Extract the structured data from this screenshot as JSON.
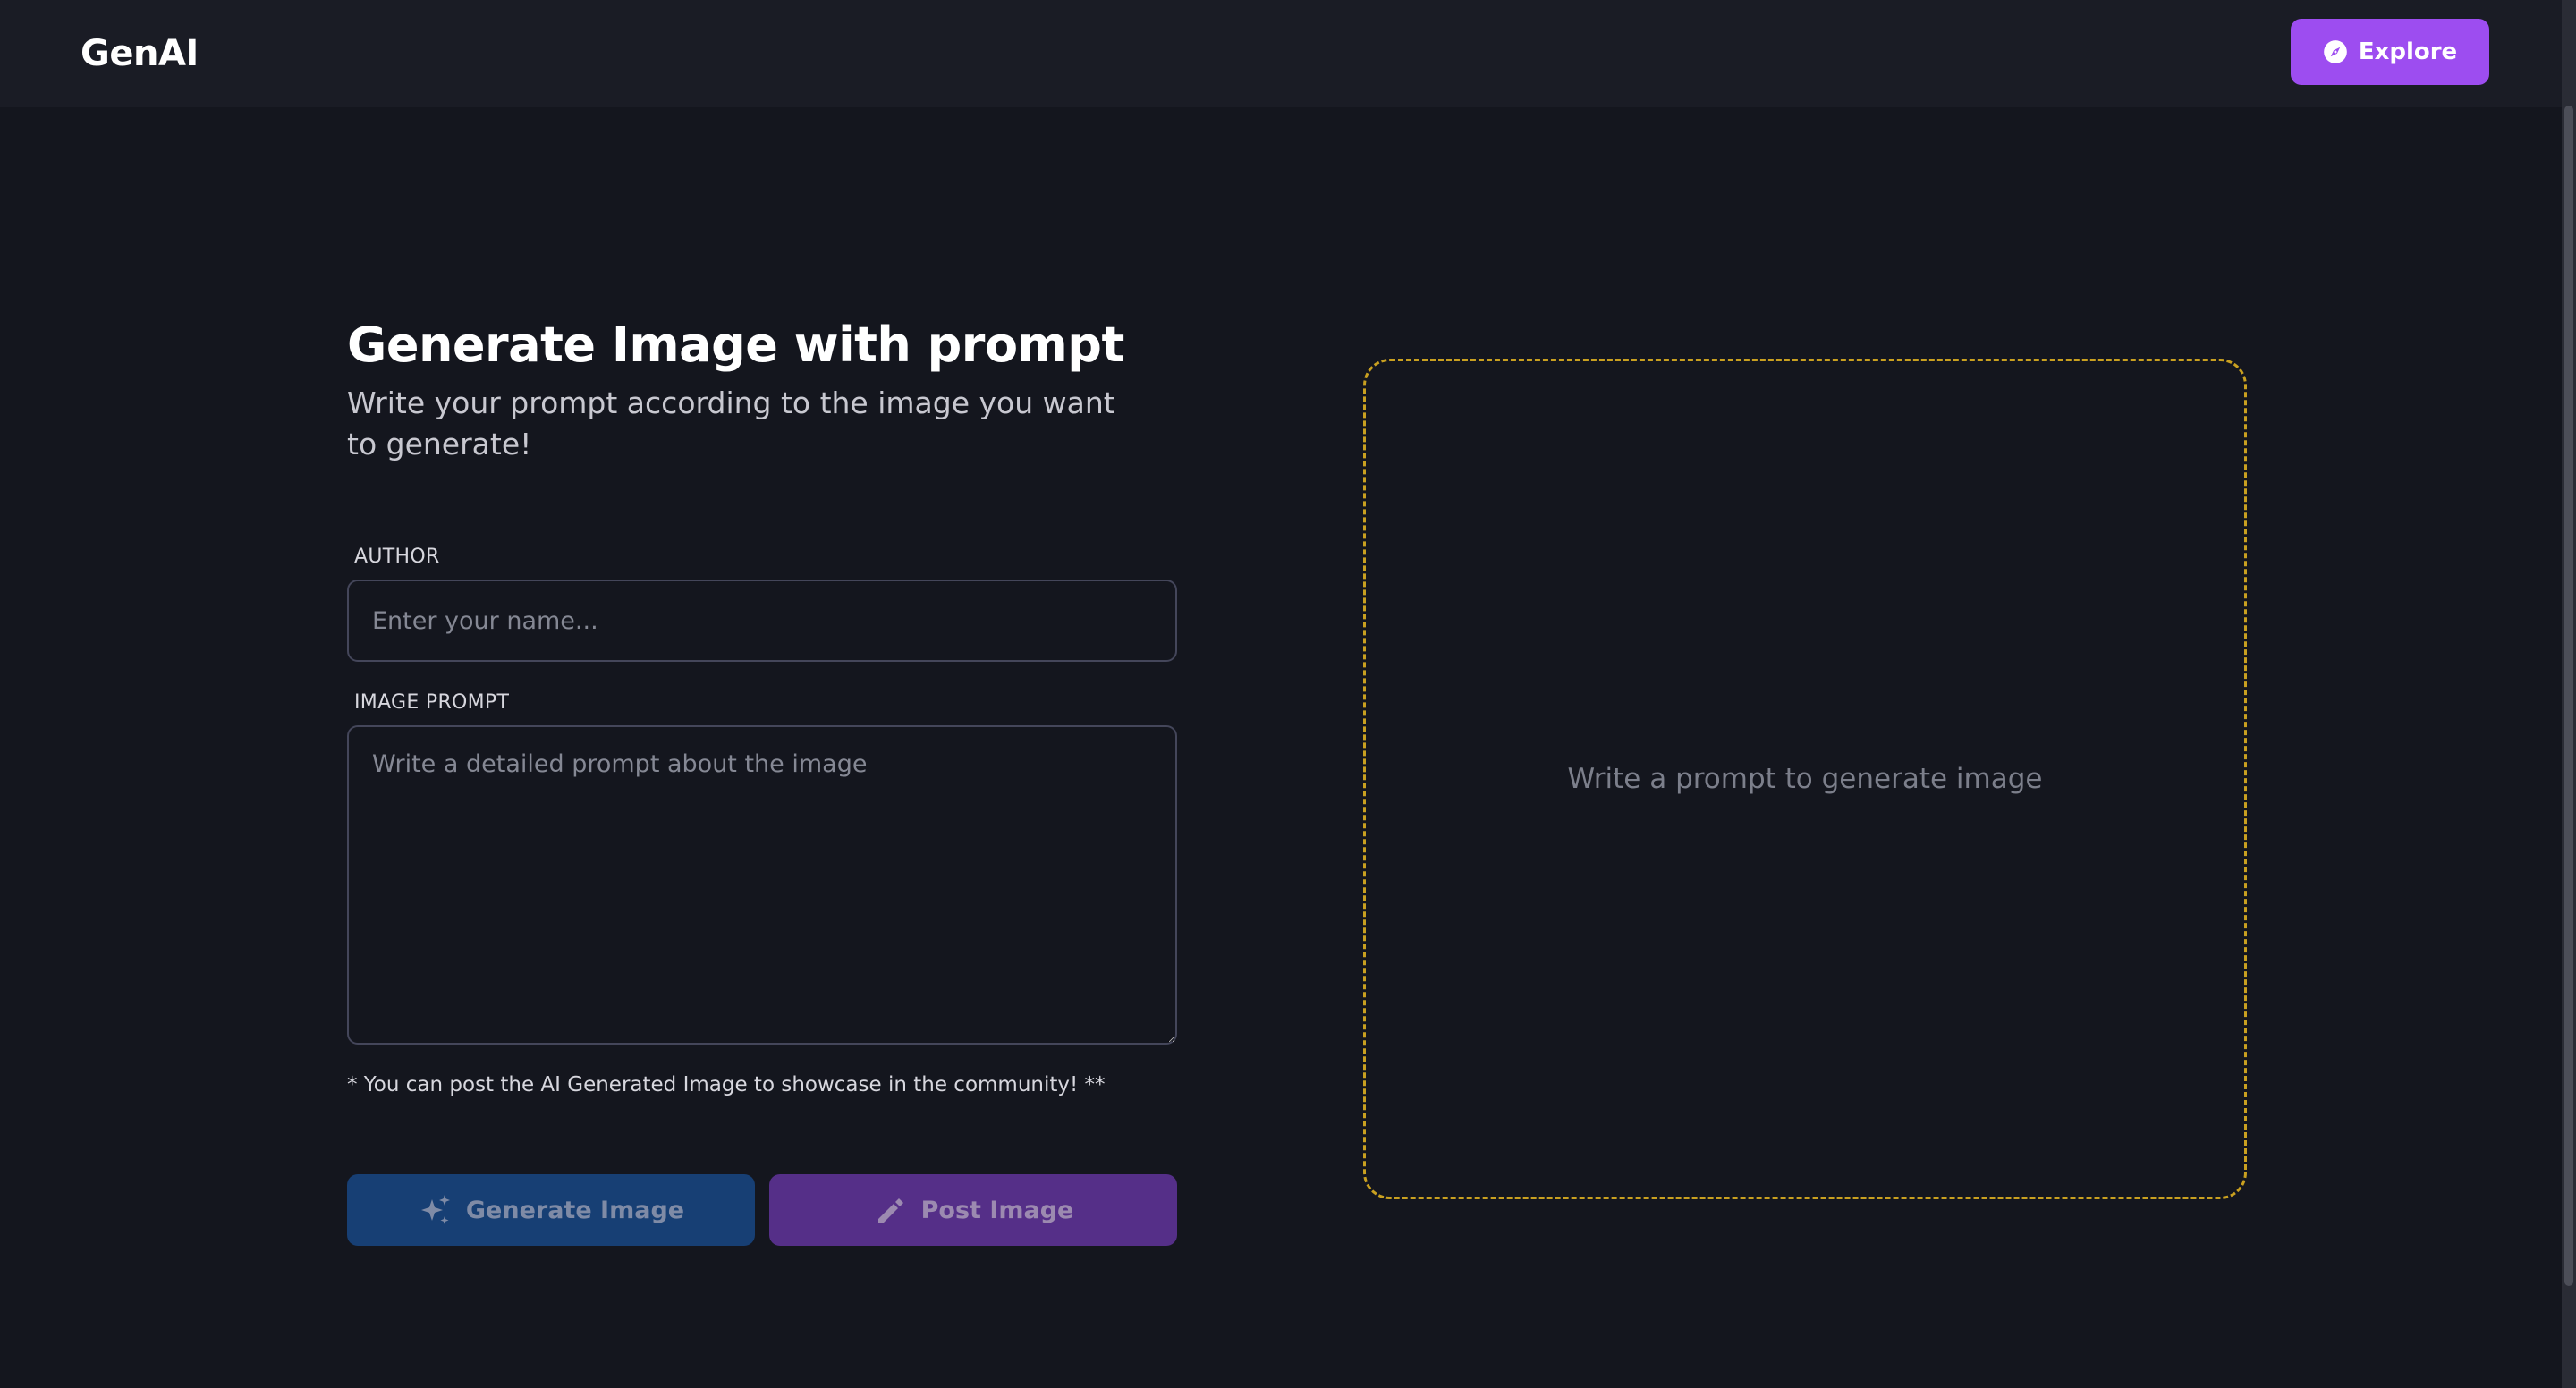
{
  "navbar": {
    "logo": "GenAI",
    "explore_label": "Explore"
  },
  "main": {
    "title": "Generate Image with prompt",
    "subtitle": "Write your prompt according to the image you want to generate!",
    "author": {
      "label": "AUTHOR",
      "placeholder": "Enter your name...",
      "value": ""
    },
    "prompt": {
      "label": "IMAGE PROMPT",
      "placeholder": "Write a detailed prompt about the image",
      "value": ""
    },
    "note": "* You can post the AI Generated Image to showcase in the community! **",
    "generate_label": "Generate Image",
    "post_label": "Post Image"
  },
  "preview": {
    "placeholder": "Write a prompt to generate image"
  },
  "icons": {
    "explore": "compass-icon",
    "generate": "sparkles-icon",
    "post": "pencil-icon"
  },
  "colors": {
    "background": "#14161e",
    "navbar": "#1a1c25",
    "accent_purple": "#9d4df0",
    "generate_button": "#173f74",
    "post_button": "#552f88",
    "preview_border": "#c9a020"
  }
}
